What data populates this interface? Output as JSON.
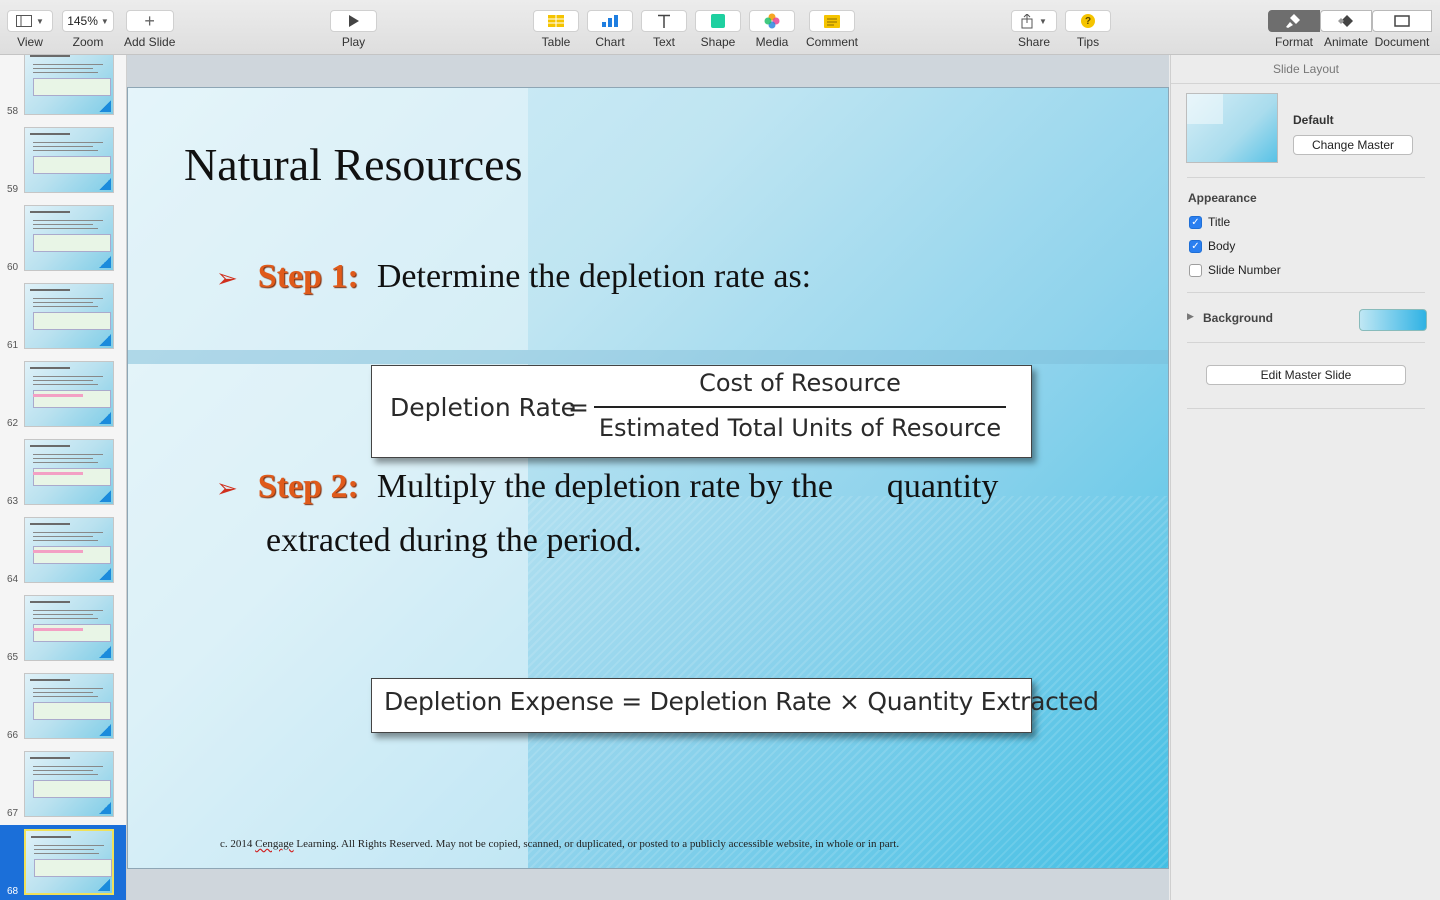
{
  "toolbar": {
    "view_label": "View",
    "zoom_value": "145%",
    "zoom_label": "Zoom",
    "add_slide_label": "Add Slide",
    "play_label": "Play",
    "table_label": "Table",
    "chart_label": "Chart",
    "text_label": "Text",
    "shape_label": "Shape",
    "media_label": "Media",
    "comment_label": "Comment",
    "share_label": "Share",
    "tips_label": "Tips",
    "tips_icon_text": "?",
    "format_label": "Format",
    "animate_label": "Animate",
    "document_label": "Document"
  },
  "navigator": {
    "slides": [
      {
        "number": "58",
        "selected": false
      },
      {
        "number": "59",
        "selected": false
      },
      {
        "number": "60",
        "selected": false
      },
      {
        "number": "61",
        "selected": false
      },
      {
        "number": "62",
        "selected": false
      },
      {
        "number": "63",
        "selected": false
      },
      {
        "number": "64",
        "selected": false
      },
      {
        "number": "65",
        "selected": false
      },
      {
        "number": "66",
        "selected": false
      },
      {
        "number": "67",
        "selected": false
      },
      {
        "number": "68",
        "selected": true
      }
    ]
  },
  "slide": {
    "title": "Natural Resources",
    "step1_marker": "➢",
    "step1_label": "Step 1:",
    "step1_text": "Determine the depletion rate as:",
    "formula1_left": "Depletion Rate",
    "formula1_eq": "=",
    "formula1_numerator": "Cost of Resource",
    "formula1_denominator": "Estimated Total Units of Resource",
    "step2_marker": "➢",
    "step2_label": "Step 2:",
    "step2_text_line1a": "Multiply the depletion rate by the",
    "step2_text_line1b": "quantity",
    "step2_text_line2": "extracted during the period.",
    "formula2": "Depletion Expense = Depletion Rate × Quantity Extracted",
    "footer_pre": "c. 2014 ",
    "footer_brand": "Cengage",
    "footer_post": " Learning.   All Rights Reserved.  May not be copied, scanned, or duplicated, or posted to a publicly accessible website, in whole or in part."
  },
  "inspector": {
    "header": "Slide Layout",
    "master_name": "Default",
    "change_master_label": "Change Master",
    "appearance_label": "Appearance",
    "title_checkbox": {
      "label": "Title",
      "checked": true
    },
    "body_checkbox": {
      "label": "Body",
      "checked": true
    },
    "slide_number_checkbox": {
      "label": "Slide Number",
      "checked": false
    },
    "background_label": "Background",
    "background_color": "#2fb2e4",
    "edit_master_label": "Edit Master Slide"
  },
  "colors": {
    "accent": "#1b6fd9",
    "step_orange": "#e05a1a",
    "arrow_red": "#d0301e"
  }
}
